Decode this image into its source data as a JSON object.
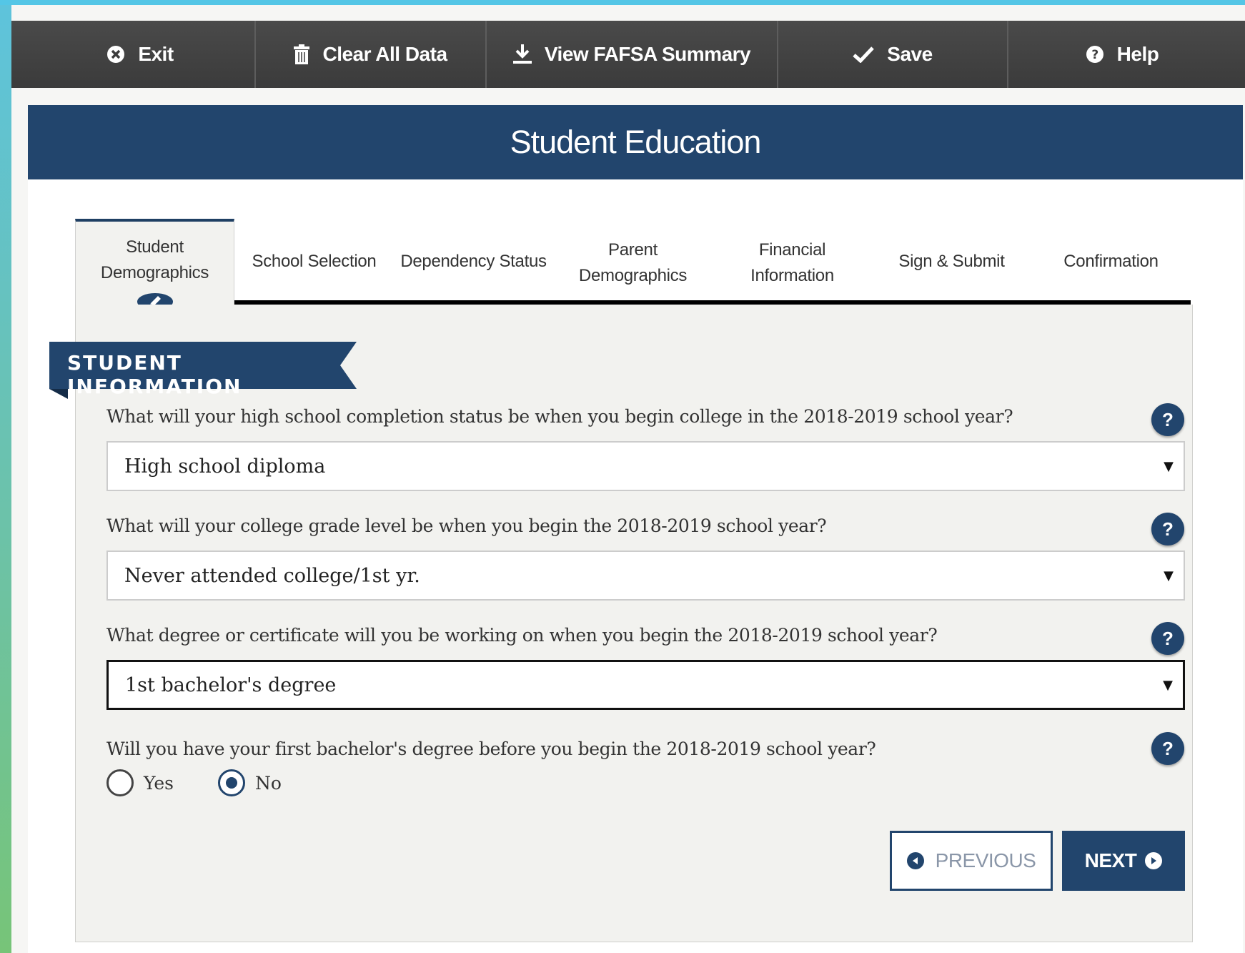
{
  "toolbar": {
    "exit_label": "Exit",
    "clear_label": "Clear All Data",
    "summary_label": "View FAFSA Summary",
    "save_label": "Save",
    "help_label": "Help"
  },
  "page_title": "Student Education",
  "tabs": [
    {
      "label": "Student Demographics",
      "active": true
    },
    {
      "label": "School Selection"
    },
    {
      "label": "Dependency Status"
    },
    {
      "label": "Parent Demographics"
    },
    {
      "label": "Financial Information"
    },
    {
      "label": "Sign & Submit"
    },
    {
      "label": "Confirmation"
    }
  ],
  "tab_lines": {
    "t0a": "Student",
    "t0b": "Demographics",
    "t3a": "Parent",
    "t3b": "Demographics",
    "t4a": "Financial",
    "t4b": "Information"
  },
  "section_title": "STUDENT INFORMATION",
  "questions": [
    {
      "text": "What will your high school completion status be when you begin college in the 2018-2019 school year?",
      "value": "High school diploma"
    },
    {
      "text": "What will your college grade level be when you begin the 2018-2019 school year?",
      "value": "Never attended college/1st yr."
    },
    {
      "text": "What degree or certificate will you be working on when you begin the 2018-2019 school year?",
      "value": "1st bachelor's degree"
    },
    {
      "text": "Will you have your first bachelor's degree before you begin the 2018-2019 school year?",
      "options": [
        "Yes",
        "No"
      ],
      "selected": "No"
    }
  ],
  "help_glyph": "?",
  "nav": {
    "previous_label": "PREVIOUS",
    "next_label": "NEXT"
  },
  "colors": {
    "navy": "#22456d",
    "toolbar": "#3b3b3b",
    "accent": "#54c6e6"
  }
}
